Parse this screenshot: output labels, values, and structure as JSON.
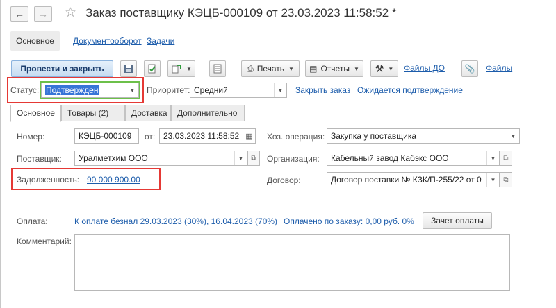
{
  "window": {
    "title": "Заказ поставщику КЭЦБ-000109 от 23.03.2023 11:58:52 *"
  },
  "nav": {
    "back_icon": "arrow-left-icon",
    "forward_icon": "arrow-right-icon",
    "favorite_icon": "star-icon"
  },
  "topnav": {
    "items": [
      "Основное",
      "Документооборот",
      "Задачи"
    ]
  },
  "toolbar": {
    "post_close": "Провести и закрыть",
    "print": "Печать",
    "reports": "Отчеты",
    "files_do": "Файлы ДО",
    "files": "Файлы"
  },
  "status": {
    "label": "Статус:",
    "value": "Подтвержден",
    "priority_label": "Приоритет:",
    "priority_value": "Средний",
    "close_order": "Закрыть заказ",
    "awaiting": "Ожидается подтверждение"
  },
  "tabs": [
    "Основное",
    "Товары (2)",
    "Доставка",
    "Дополнительно"
  ],
  "form": {
    "number_label": "Номер:",
    "number_value": "КЭЦБ-000109",
    "from_label": "от:",
    "date_value": "23.03.2023 11:58:52",
    "operation_label": "Хоз. операция:",
    "operation_value": "Закупка у поставщика",
    "supplier_label": "Поставщик:",
    "supplier_value": "Уралметхим ООО",
    "org_label": "Организация:",
    "org_value": "Кабельный завод Кабэкс ООО",
    "debt_label": "Задолженность:",
    "debt_value": "90 000 900.00",
    "contract_label": "Договор:",
    "contract_value": "Договор поставки № КЗК/П-255/22  от 0",
    "payment_label": "Оплата:",
    "payment_link": "К оплате безнал 29.03.2023 (30%), 16.04.2023 (70%)",
    "paid_link": "Оплачено по заказу: 0,00 руб. 0%",
    "offset_button": "Зачет оплаты",
    "comment_label": "Комментарий:",
    "comment_value": ""
  },
  "colors": {
    "link": "#1c5cab",
    "highlight_red": "#e53935",
    "highlight_green": "#6cc04a",
    "selection": "#3875d7"
  }
}
